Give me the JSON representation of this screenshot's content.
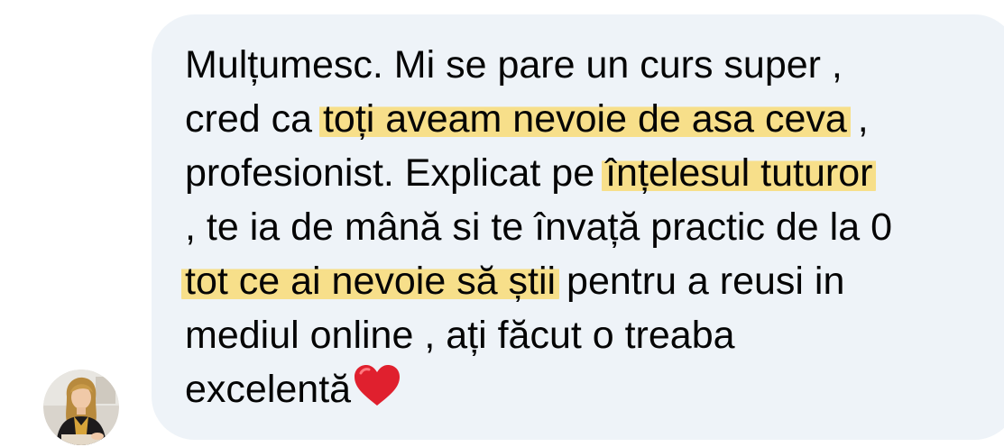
{
  "message": {
    "lines": [
      [
        {
          "text": "Mulțumesc.  Mi se pare un curs super ,",
          "highlight": false
        }
      ],
      [
        {
          "text": "cred ca ",
          "highlight": false
        },
        {
          "text": "toți aveam nevoie de asa ceva",
          "highlight": true
        },
        {
          "text": " ,",
          "highlight": false
        }
      ],
      [
        {
          "text": "profesionist.  Explicat pe ",
          "highlight": false
        },
        {
          "text": "înțelesul tuturor",
          "highlight": true
        }
      ],
      [
        {
          "text": ", te ia de mână si te învață practic de la 0",
          "highlight": false
        }
      ],
      [
        {
          "text": "tot ce ai nevoie să știi",
          "highlight": true
        },
        {
          "text": " pentru a reusi in",
          "highlight": false
        }
      ],
      [
        {
          "text": "mediul online , ați făcut o treaba",
          "highlight": false
        }
      ],
      [
        {
          "text": "excelentă",
          "highlight": false
        }
      ]
    ],
    "end_emoji": "heart-icon",
    "highlight_color": "#f7df8a",
    "bubble_color": "#eef3f8",
    "text_color": "#050505"
  },
  "sender": {
    "avatar_icon": "user-avatar-photo"
  }
}
